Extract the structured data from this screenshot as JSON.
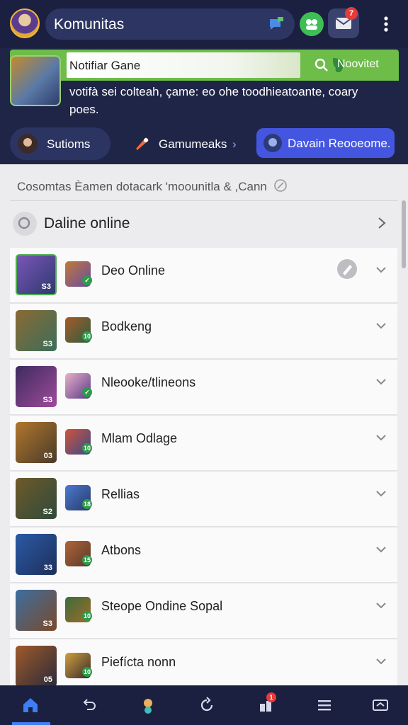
{
  "header": {
    "title": "Komunitas",
    "mail_badge": "7"
  },
  "notification": {
    "title": "Notifiar Gane",
    "link_label": "Noovitet",
    "description": "votifà sei colteah, çame: eo ohe toodhieatoante, coary poes."
  },
  "tabs": [
    {
      "label": "Sutioms"
    },
    {
      "label": "Gamumeaks",
      "chevron": "›"
    },
    {
      "label": "Davain Reooeome."
    }
  ],
  "subheader": "Cosomtas Èamen dotacark 'moounitla & ,Cann",
  "section": {
    "title": "Daline online"
  },
  "rows": [
    {
      "name": "Deo Online",
      "thumb_num": "S3",
      "mini_num": "✓",
      "colors": [
        "#7b55b8",
        "#2d3a6e"
      ],
      "mini_colors": [
        "#c07a3a",
        "#6c4aa1"
      ]
    },
    {
      "name": "Bodkeng",
      "thumb_num": "S3",
      "mini_num": "10",
      "colors": [
        "#8a6a34",
        "#3c6e5a"
      ],
      "mini_colors": [
        "#a55a2a",
        "#2f5e3f"
      ]
    },
    {
      "name": "Nleooke/tlineons",
      "thumb_num": "S3",
      "mini_num": "✓",
      "colors": [
        "#3c2c5e",
        "#a04a9a"
      ],
      "mini_colors": [
        "#e8b1c6",
        "#5a3a8a"
      ]
    },
    {
      "name": "Mlam Odlage",
      "thumb_num": "03",
      "mini_num": "10",
      "colors": [
        "#b0772c",
        "#4a3a2a"
      ],
      "mini_colors": [
        "#d0543a",
        "#3a4a8a"
      ]
    },
    {
      "name": "Rellias",
      "thumb_num": "S2",
      "mini_num": "18",
      "colors": [
        "#6e5a2a",
        "#2f4a3a"
      ],
      "mini_colors": [
        "#4a7ad0",
        "#2a3a6a"
      ]
    },
    {
      "name": "Atbons",
      "thumb_num": "33",
      "mini_num": "15",
      "colors": [
        "#2a5aa6",
        "#1e2f5a"
      ],
      "mini_colors": [
        "#b0643a",
        "#5a3a2a"
      ]
    },
    {
      "name": "Steope Ondine Sopal",
      "thumb_num": "S3",
      "mini_num": "10",
      "colors": [
        "#3c6ea0",
        "#7a4a2a"
      ],
      "mini_colors": [
        "#3a6e3a",
        "#a06a2a"
      ]
    },
    {
      "name": "Piefícta nonn",
      "thumb_num": "05",
      "mini_num": "10",
      "colors": [
        "#a05a2a",
        "#2a2a3a"
      ],
      "mini_colors": [
        "#d0a040",
        "#3a2a2a"
      ]
    }
  ],
  "bottom_nav": [
    {
      "icon": "home-icon",
      "active": true
    },
    {
      "icon": "back-arrow-icon"
    },
    {
      "icon": "group-icon"
    },
    {
      "icon": "refresh-icon"
    },
    {
      "icon": "notification-icon",
      "badge": "1"
    },
    {
      "icon": "list-icon"
    },
    {
      "icon": "swap-icon"
    }
  ],
  "colors": {
    "header_bg": "#1f2547",
    "accent_green": "#6dbd48",
    "accent_blue": "#4456e0",
    "badge_red": "#e63b3b"
  }
}
